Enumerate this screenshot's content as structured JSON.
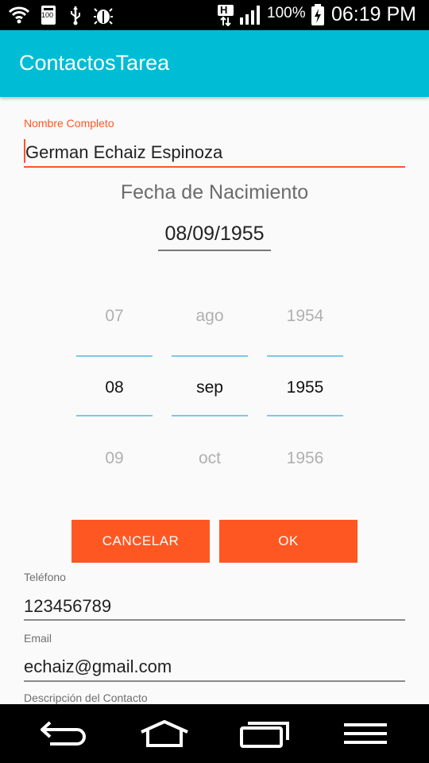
{
  "status_bar": {
    "battery": "100%",
    "time": "06:19 PM",
    "network": "H",
    "notification_badge": "100"
  },
  "app": {
    "title": "ContactosTarea"
  },
  "form": {
    "name_label": "Nombre Completo",
    "name_value": "German Echaiz Espinoza",
    "phone_label": "Teléfono",
    "phone_value": "123456789",
    "email_label": "Email",
    "email_value": "echaiz@gmail.com",
    "description_label": "Descripción del Contacto"
  },
  "date_picker": {
    "title": "Fecha de Nacimiento",
    "value": "08/09/1955",
    "day": {
      "prev": "07",
      "selected": "08",
      "next": "09"
    },
    "month": {
      "prev": "ago",
      "selected": "sep",
      "next": "oct"
    },
    "year": {
      "prev": "1954",
      "selected": "1955",
      "next": "1956"
    },
    "cancel_label": "CANCELAR",
    "ok_label": "OK"
  },
  "colors": {
    "appbar": "#00bcd4",
    "accent": "#ff5722",
    "divider": "#7ec8e3"
  },
  "icons": [
    "wifi-icon",
    "usb-icon",
    "debug-icon",
    "signal-icon",
    "battery-charging-icon",
    "back-icon",
    "home-icon",
    "recents-icon",
    "menu-icon"
  ]
}
